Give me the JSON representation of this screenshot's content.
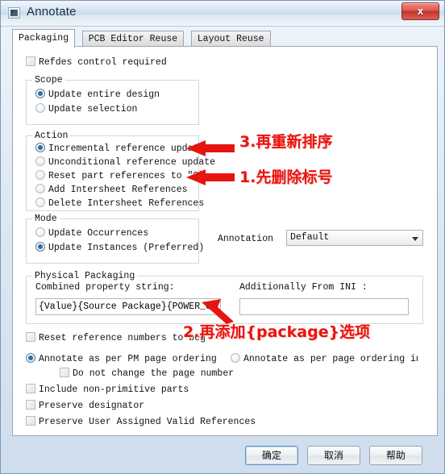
{
  "window": {
    "title": "Annotate",
    "close_label": "x",
    "app_icon": "app-window-icon"
  },
  "tabs": [
    {
      "label": "Packaging",
      "active": true
    },
    {
      "label": "PCB Editor Reuse",
      "active": false
    },
    {
      "label": "Layout Reuse",
      "active": false
    }
  ],
  "refdes_control": {
    "label": "Refdes control required",
    "checked": false
  },
  "scope": {
    "legend": "Scope",
    "options": [
      {
        "label": "Update entire design",
        "selected": true
      },
      {
        "label": "Update selection",
        "selected": false
      }
    ]
  },
  "action": {
    "legend": "Action",
    "options": [
      {
        "label": "Incremental reference update",
        "selected": true
      },
      {
        "label": "Unconditional reference update",
        "selected": false
      },
      {
        "label": "Reset part references to \"?\"",
        "selected": false
      },
      {
        "label": "Add Intersheet References",
        "selected": false
      },
      {
        "label": "Delete Intersheet References",
        "selected": false
      }
    ]
  },
  "mode": {
    "legend": "Mode",
    "options": [
      {
        "label": "Update Occurrences",
        "selected": false
      },
      {
        "label": "Update Instances (Preferred)",
        "selected": true
      }
    ]
  },
  "annotation": {
    "label": "Annotation",
    "value": "Default"
  },
  "physical_packaging": {
    "legend": "Physical Packaging",
    "combined_label": "Combined property string:",
    "combined_value": "{Value}{Source Package}{POWER_GROUP}",
    "ini_label": "Additionally From INI :",
    "ini_value": "",
    "ini_placeholder": ""
  },
  "options": {
    "reset_reference_numbers": {
      "label": "Reset reference numbers to beg",
      "checked": false
    },
    "annotate_pm_page": {
      "label": "Annotate as per PM page ordering",
      "selected": true
    },
    "annotate_title_block_page": {
      "label": "Annotate as per page ordering in the ti",
      "selected": false
    },
    "do_not_change_page_number": {
      "label": "Do not change the page number",
      "checked": false
    },
    "include_non_primitive": {
      "label": "Include non-primitive parts",
      "checked": false
    },
    "preserve_designator": {
      "label": "Preserve designator",
      "checked": false
    },
    "preserve_user_assigned": {
      "label": "Preserve User Assigned Valid References",
      "checked": false
    }
  },
  "annotations": [
    {
      "text": "3.再重新排序"
    },
    {
      "text": "1.先删除标号"
    },
    {
      "text": "2.再添加{package}选项"
    }
  ],
  "buttons": {
    "ok": "确定",
    "cancel": "取消",
    "help": "帮助"
  },
  "colors": {
    "annotation_red": "#e8140f",
    "accent_blue": "#2b6ea8",
    "close_red": "#c3342b"
  }
}
